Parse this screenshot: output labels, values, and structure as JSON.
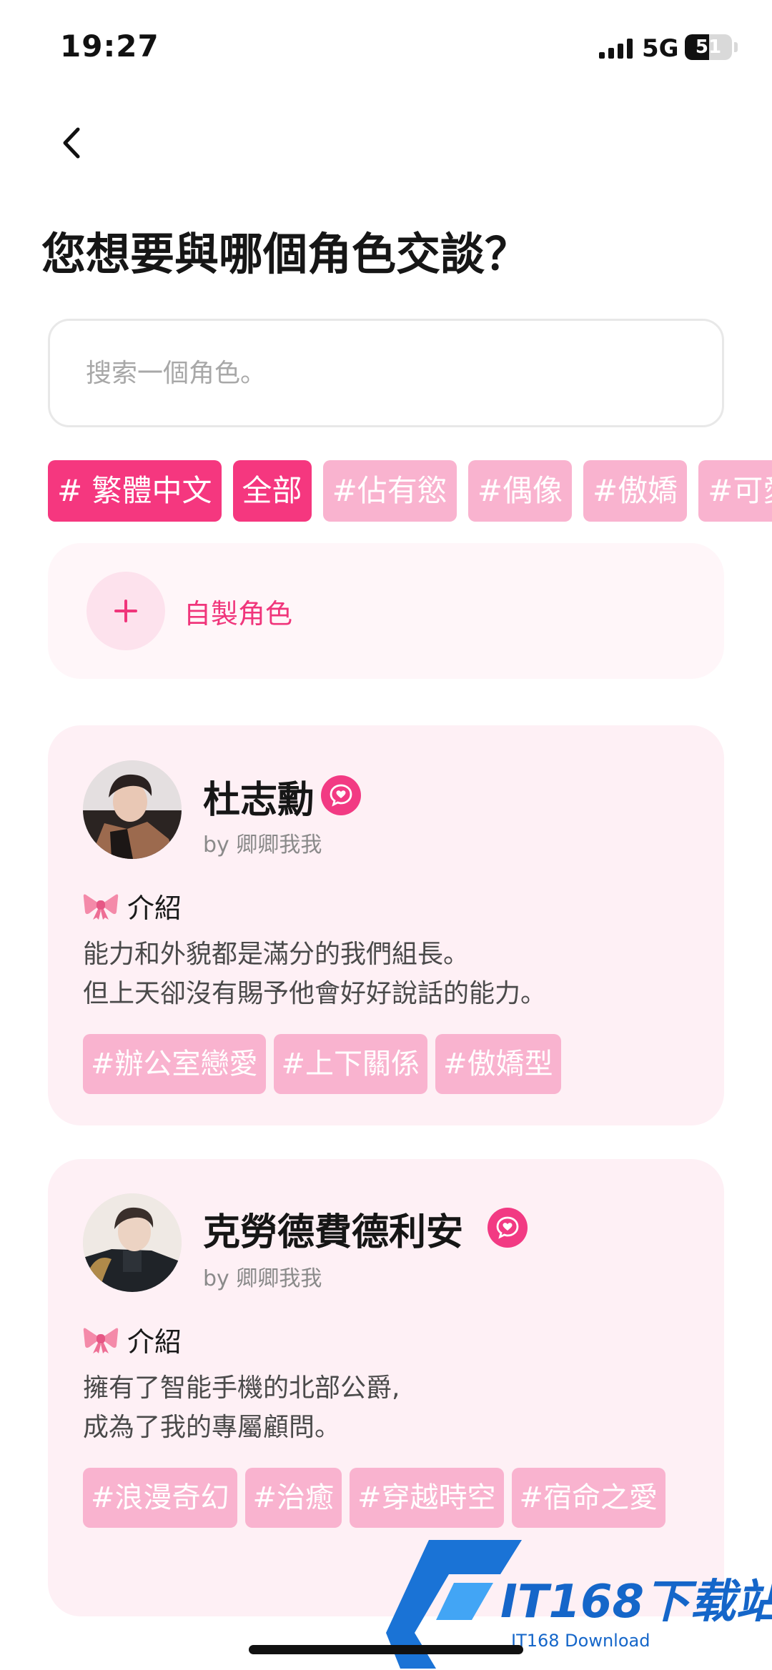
{
  "status_bar": {
    "time": "19:27",
    "network": "5G",
    "battery": "51",
    "battery_level": 0.51
  },
  "header": {
    "title": "您想要與哪個角色交談？"
  },
  "search": {
    "placeholder": "搜索一個角色。"
  },
  "categories": [
    {
      "label": "# 繁體中文",
      "active": true
    },
    {
      "label": "全部",
      "active": true
    },
    {
      "label": "#佔有慾",
      "active": false
    },
    {
      "label": "#偶像",
      "active": false
    },
    {
      "label": "#傲嬌",
      "active": false
    },
    {
      "label": "#可愛",
      "active": false
    }
  ],
  "create": {
    "label": "自製角色"
  },
  "characters": [
    {
      "name": "杜志勳",
      "author": "by 卿卿我我",
      "intro_label": "介紹",
      "description": [
        "能力和外貌都是滿分的我們組長。",
        "但上天卻沒有賜予他會好好說話的能力。"
      ],
      "tags": [
        "#辦公室戀愛",
        "#上下關係",
        "#傲嬌型"
      ]
    },
    {
      "name": "克勞德費德利安",
      "author": "by 卿卿我我",
      "intro_label": "介紹",
      "description": [
        "擁有了智能手機的北部公爵,",
        "成為了我的專屬顧問。"
      ],
      "tags": [
        "#浪漫奇幻",
        "#治癒",
        "#穿越時空",
        "#宿命之愛"
      ]
    }
  ],
  "watermark": {
    "title": "IT168下载站",
    "subtitle": "IT168 Download"
  },
  "colors": {
    "accent": "#f5377f",
    "chip_light": "#f9b3cf",
    "card_bg": "#fef0f5"
  }
}
